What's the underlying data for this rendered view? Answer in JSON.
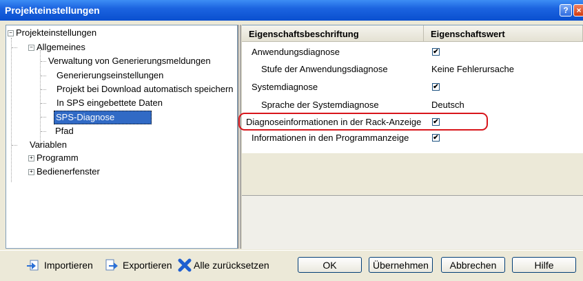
{
  "window": {
    "title": "Projekteinstellungen"
  },
  "tree": {
    "root": "Projekteinstellungen",
    "allgemeines": "Allgemeines",
    "children": [
      "Verwaltung von Generierungsmeldungen",
      "Generierungseinstellungen",
      "Projekt bei Download automatisch speichern",
      "In SPS eingebettete Daten",
      "SPS-Diagnose",
      "Pfad"
    ],
    "variablen": "Variablen",
    "programm": "Programm",
    "bedienerfenster": "Bedienerfenster",
    "selected": "SPS-Diagnose"
  },
  "grid": {
    "col1": "Eigenschaftsbeschriftung",
    "col2": "Eigenschaftswert",
    "rows": [
      {
        "name": "Anwendungsdiagnose",
        "checked": true
      },
      {
        "name": "Stufe der Anwendungsdiagnose",
        "value": "Keine Fehlerursache"
      },
      {
        "name": "Systemdiagnose",
        "checked": true
      },
      {
        "name": "Sprache der Systemdiagnose",
        "value": "Deutsch"
      },
      {
        "name": "Diagnoseinformationen in der Rack-Anzeige",
        "checked": true
      },
      {
        "name": "Informationen in den Programmanzeige",
        "checked": true
      }
    ],
    "highlight_color": "#d8141a"
  },
  "footer": {
    "import": "Importieren",
    "export": "Exportieren",
    "reset": "Alle zurücksetzen",
    "ok": "OK",
    "apply": "Übernehmen",
    "cancel": "Abbrechen",
    "help": "Hilfe"
  },
  "title_buttons": {
    "help": "?",
    "close": "×"
  },
  "tree_toggles": {
    "expanded": "−",
    "collapsed": "+"
  },
  "checkmark": "✔",
  "colors": {
    "titlebar": "#0a4fcf",
    "selection": "#316ac5",
    "reset_icon": "#1f5fd0"
  }
}
